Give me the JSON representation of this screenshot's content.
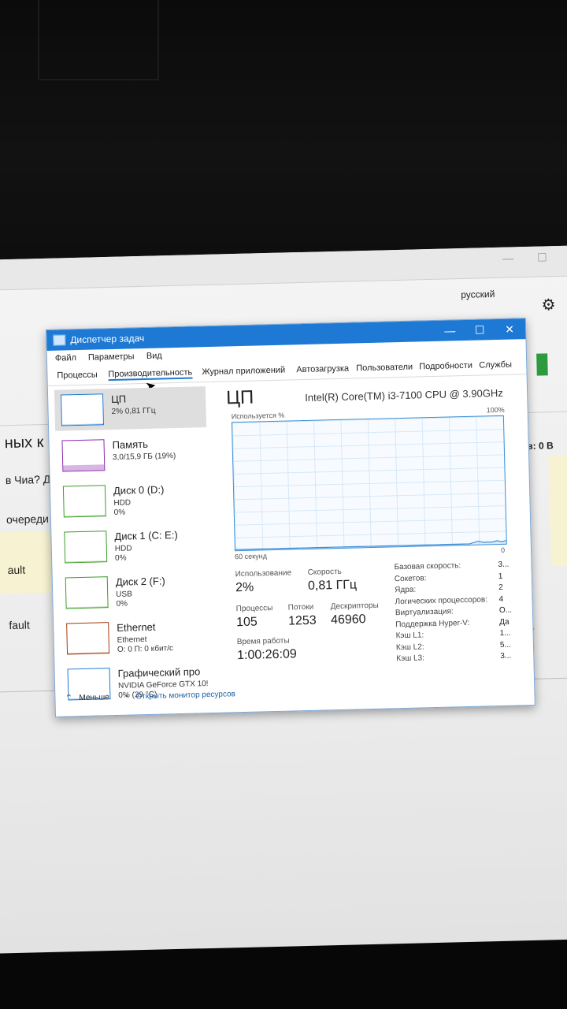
{
  "background_app": {
    "window_controls": [
      "—",
      "☐"
    ],
    "top_right_text": "русский",
    "heading_fragment": "ных к",
    "text_fragments": [
      "в Чиа? Доба",
      "очереди",
      "ault",
      "fault"
    ],
    "right_fragment": "ов: 0 В",
    "settings_icon": "gear-icon",
    "accent_green": "#2e9a3e",
    "highlight_yellow": "#f6f2d2"
  },
  "window": {
    "title": "Диспетчер задач",
    "controls": {
      "minimize": "—",
      "maximize": "☐",
      "close": "✕"
    },
    "title_bar_color": "#1e79d4"
  },
  "menu": [
    "Файл",
    "Параметры",
    "Вид"
  ],
  "tabs": [
    {
      "label": "Процессы",
      "active": false
    },
    {
      "label": "Производительность",
      "active": true
    },
    {
      "label": "Журнал приложений",
      "active": false
    },
    {
      "label": "Автозагрузка",
      "active": false
    },
    {
      "label": "Пользователи",
      "active": false
    },
    {
      "label": "Подробности",
      "active": false
    },
    {
      "label": "Службы",
      "active": false
    }
  ],
  "sidebar": [
    {
      "name": "ЦП",
      "line1": "2% 0,81 ГГц",
      "line2": "",
      "line3": "",
      "selected": true,
      "color": "#1e79d4",
      "usage": 0.02
    },
    {
      "name": "Память",
      "line1": "3,0/15,9 ГБ (19%)",
      "line2": "",
      "line3": "",
      "selected": false,
      "color": "#8b2db0",
      "usage": 0.19
    },
    {
      "name": "Диск 0 (D:)",
      "line1": "HDD",
      "line2": "0%",
      "line3": "",
      "selected": false,
      "color": "#3c9d27",
      "usage": 0.0
    },
    {
      "name": "Диск 1 (C: E:)",
      "line1": "HDD",
      "line2": "0%",
      "line3": "",
      "selected": false,
      "color": "#3c9d27",
      "usage": 0.0
    },
    {
      "name": "Диск 2 (F:)",
      "line1": "USB",
      "line2": "0%",
      "line3": "",
      "selected": false,
      "color": "#3c9d27",
      "usage": 0.0
    },
    {
      "name": "Ethernet",
      "line1": "Ethernet",
      "line2": "О: 0 П: 0 кбит/с",
      "line3": "",
      "selected": false,
      "color": "#a33b14",
      "usage": 0.0
    },
    {
      "name": "Графический про",
      "line1": "NVIDIA GeForce GTX 10!",
      "line2": "0% (39 °C)",
      "line3": "",
      "selected": false,
      "color": "#1e79d4",
      "usage": 0.0
    }
  ],
  "cpu_panel": {
    "title": "ЦП",
    "model": "Intel(R) Core(TM) i3-7100 CPU @ 3.90GHz",
    "graph_top_left": "Используется %",
    "graph_top_right": "100%",
    "graph_bottom_left": "60 секунд",
    "graph_bottom_right": "0",
    "line_color": "#3c8fd6",
    "usage_history_percent": [
      0,
      0,
      0,
      0,
      0,
      0,
      0,
      0,
      0,
      0,
      0,
      0,
      0,
      0,
      0,
      0,
      0,
      0,
      0,
      0,
      0,
      0,
      0,
      0,
      0,
      0,
      0,
      0,
      0,
      0,
      0,
      0,
      0,
      0,
      0,
      0,
      0,
      0,
      0,
      0,
      0,
      0,
      0,
      0,
      0,
      0,
      0,
      0,
      0,
      0,
      0,
      0,
      1,
      2,
      1,
      1,
      1,
      2,
      1,
      2
    ]
  },
  "stats": {
    "utilization_label": "Использование",
    "utilization_value": "2%",
    "speed_label": "Скорость",
    "speed_value": "0,81 ГГц",
    "processes_label": "Процессы",
    "processes_value": "105",
    "threads_label": "Потоки",
    "threads_value": "1253",
    "handles_label": "Дескрипторы",
    "handles_value": "46960",
    "uptime_label": "Время работы",
    "uptime_value": "1:00:26:09"
  },
  "info": [
    {
      "key": "Базовая скорость:",
      "value": "3..."
    },
    {
      "key": "Сокетов:",
      "value": "1"
    },
    {
      "key": "Ядра:",
      "value": "2"
    },
    {
      "key": "Логических процессоров:",
      "value": "4"
    },
    {
      "key": "Виртуализация:",
      "value": "О..."
    },
    {
      "key": "Поддержка Hyper-V:",
      "value": "Да"
    },
    {
      "key": "Кэш L1:",
      "value": "1..."
    },
    {
      "key": "Кэш L2:",
      "value": "5..."
    },
    {
      "key": "Кэш L3:",
      "value": "3..."
    }
  ],
  "footer": {
    "less_label": "Меньше",
    "less_icon": "chevron-up-icon",
    "monitor_label": "Открыть монитор ресурсов",
    "monitor_icon": "resource-monitor-icon"
  }
}
